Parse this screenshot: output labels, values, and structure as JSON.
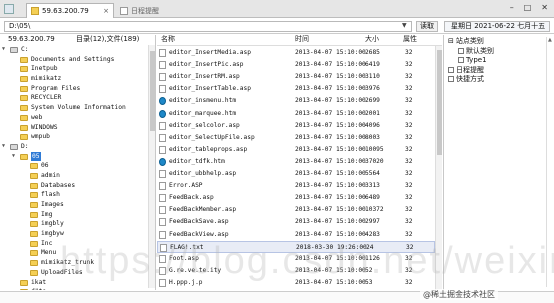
{
  "tabs": [
    {
      "label": "59.63.200.79"
    },
    {
      "label": "日程提醒"
    }
  ],
  "address": {
    "value": "D:\\05\\",
    "read_label": "读取",
    "datetime": "星期日 2021-06-22 七月十五"
  },
  "left": {
    "ip": "59.63.200.79",
    "count": "目录(12),文件(189)",
    "tree": [
      {
        "label": "C:",
        "depth": 0,
        "expander": "▼",
        "folder": false
      },
      {
        "label": "Documents and Settings",
        "depth": 1,
        "expander": "",
        "folder": true
      },
      {
        "label": "Inetpub",
        "depth": 1,
        "expander": "",
        "folder": true
      },
      {
        "label": "mimikatz",
        "depth": 1,
        "expander": "",
        "folder": true
      },
      {
        "label": "Program Files",
        "depth": 1,
        "expander": "",
        "folder": true
      },
      {
        "label": "RECYCLER",
        "depth": 1,
        "expander": "",
        "folder": true
      },
      {
        "label": "System Volume Information",
        "depth": 1,
        "expander": "",
        "folder": true
      },
      {
        "label": "web",
        "depth": 1,
        "expander": "",
        "folder": true
      },
      {
        "label": "WINDOWS",
        "depth": 1,
        "expander": "",
        "folder": true
      },
      {
        "label": "wmpub",
        "depth": 1,
        "expander": "",
        "folder": true
      },
      {
        "label": "D:",
        "depth": 0,
        "expander": "▼",
        "folder": false
      },
      {
        "label": "05",
        "depth": 1,
        "expander": "▼",
        "folder": true,
        "selected": true
      },
      {
        "label": "06",
        "depth": 2,
        "expander": "",
        "folder": true
      },
      {
        "label": "admin",
        "depth": 2,
        "expander": "",
        "folder": true
      },
      {
        "label": "Databases",
        "depth": 2,
        "expander": "",
        "folder": true
      },
      {
        "label": "flash",
        "depth": 2,
        "expander": "",
        "folder": true
      },
      {
        "label": "Images",
        "depth": 2,
        "expander": "",
        "folder": true
      },
      {
        "label": "Img",
        "depth": 2,
        "expander": "",
        "folder": true
      },
      {
        "label": "imgbly",
        "depth": 2,
        "expander": "",
        "folder": true
      },
      {
        "label": "imgbyw",
        "depth": 2,
        "expander": "",
        "folder": true
      },
      {
        "label": "Inc",
        "depth": 2,
        "expander": "",
        "folder": true
      },
      {
        "label": "Menu",
        "depth": 2,
        "expander": "",
        "folder": true
      },
      {
        "label": "mimikatz_trunk",
        "depth": 2,
        "expander": "",
        "folder": true
      },
      {
        "label": "UploadFiles",
        "depth": 2,
        "expander": "",
        "folder": true
      },
      {
        "label": "ikat",
        "depth": 1,
        "expander": "",
        "folder": true
      },
      {
        "label": "d\"to",
        "depth": 1,
        "expander": "",
        "folder": true
      }
    ]
  },
  "files": {
    "headers": {
      "name": "名称",
      "time": "时间",
      "size": "大小",
      "attr": "属性"
    },
    "rows": [
      {
        "name": "editor_InsertMedia.asp",
        "time": "2013-04-07 15:10:00",
        "size": "2685",
        "attr": "32",
        "icon": "doc"
      },
      {
        "name": "editor_InsertPic.asp",
        "time": "2013-04-07 15:10:00",
        "size": "6419",
        "attr": "32",
        "icon": "doc"
      },
      {
        "name": "editor_InsertRM.asp",
        "time": "2013-04-07 15:10:00",
        "size": "3110",
        "attr": "32",
        "icon": "doc"
      },
      {
        "name": "editor_InsertTable.asp",
        "time": "2013-04-07 15:10:00",
        "size": "3976",
        "attr": "32",
        "icon": "doc"
      },
      {
        "name": "editor_insmenu.htm",
        "time": "2013-04-07 15:10:00",
        "size": "2699",
        "attr": "32",
        "icon": "edge"
      },
      {
        "name": "editor_marquee.htm",
        "time": "2013-04-07 15:10:00",
        "size": "2001",
        "attr": "32",
        "icon": "edge"
      },
      {
        "name": "editor_selcolor.asp",
        "time": "2013-04-07 15:10:00",
        "size": "4096",
        "attr": "32",
        "icon": "doc"
      },
      {
        "name": "editor_SelectUpFile.asp",
        "time": "2013-04-07 15:10:00",
        "size": "8003",
        "attr": "32",
        "icon": "doc"
      },
      {
        "name": "editor_tableprops.asp",
        "time": "2013-04-07 15:10:00",
        "size": "10095",
        "attr": "32",
        "icon": "doc"
      },
      {
        "name": "editor_tdfk.htm",
        "time": "2013-04-07 15:10:00",
        "size": "37020",
        "attr": "32",
        "icon": "edge"
      },
      {
        "name": "editor_ubbhelp.asp",
        "time": "2013-04-07 15:10:00",
        "size": "5564",
        "attr": "32",
        "icon": "doc"
      },
      {
        "name": "Error.ASP",
        "time": "2013-04-07 15:10:00",
        "size": "3313",
        "attr": "32",
        "icon": "doc"
      },
      {
        "name": "FeedBack.asp",
        "time": "2013-04-07 15:10:00",
        "size": "6489",
        "attr": "32",
        "icon": "doc"
      },
      {
        "name": "FeedBackMember.asp",
        "time": "2013-04-07 15:10:00",
        "size": "10372",
        "attr": "32",
        "icon": "doc"
      },
      {
        "name": "FeedBackSave.asp",
        "time": "2013-04-07 15:10:00",
        "size": "2997",
        "attr": "32",
        "icon": "doc"
      },
      {
        "name": "FeedBackView.asp",
        "time": "2013-04-07 15:10:00",
        "size": "4283",
        "attr": "32",
        "icon": "doc"
      },
      {
        "name": "FLAG!.txt",
        "time": "2018-03-30 19:26:00",
        "size": "24",
        "attr": "32",
        "icon": "doc",
        "highlight": true
      },
      {
        "name": "Foot.asp",
        "time": "2013-04-07 15:10:00",
        "size": "1126",
        "attr": "32",
        "icon": "doc"
      },
      {
        "name": "G.re.ve.te.ity",
        "time": "2013-04-07 15:10:00",
        "size": "52",
        "attr": "32",
        "icon": "doc"
      },
      {
        "name": "H.ppp.j.p",
        "time": "2013-04-07 15:10:00",
        "size": "53",
        "attr": "32",
        "icon": "doc"
      }
    ]
  },
  "right": {
    "items": [
      {
        "label": "站点类别",
        "indent": 0,
        "expander": "⊟"
      },
      {
        "label": "默认类别",
        "indent": 1,
        "expander": ""
      },
      {
        "label": "Type1",
        "indent": 1,
        "expander": ""
      },
      {
        "label": "日程提醒",
        "indent": 0,
        "expander": ""
      },
      {
        "label": "快捷方式",
        "indent": 0,
        "expander": ""
      }
    ]
  },
  "watermark": "https://blog.csdn.net/weixin_4830687",
  "brand": "@稀土掘金技术社区"
}
